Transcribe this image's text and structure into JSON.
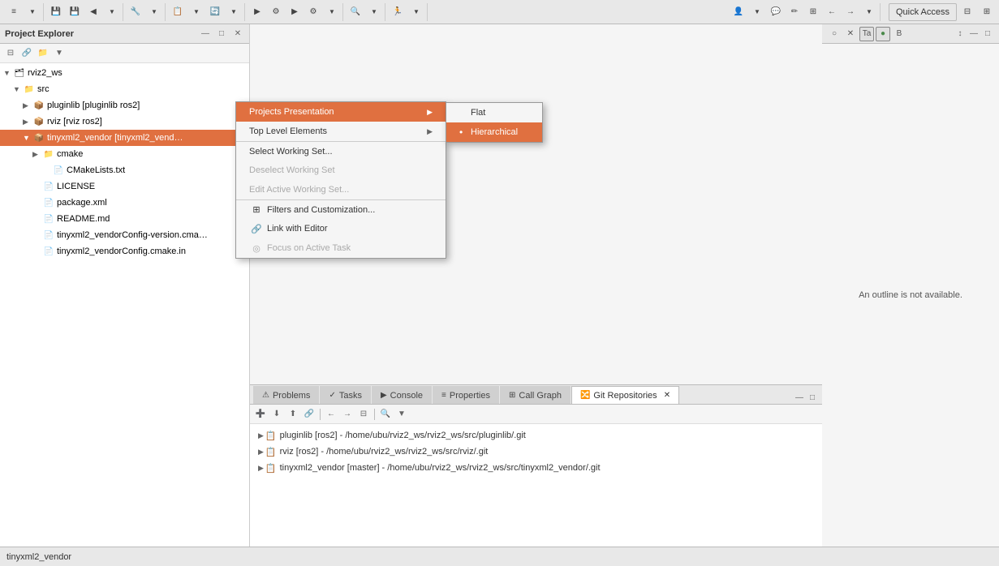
{
  "toolbar": {
    "quick_access_label": "Quick Access",
    "buttons": [
      "≡",
      "▼",
      "💾",
      "💾",
      "◀",
      "▼",
      "🔧",
      "▼",
      "📋",
      "▼",
      "🔄",
      "▼",
      "▶",
      "▼",
      "⚙",
      "▼",
      "▶",
      "⚙",
      "▼",
      "🔍",
      "▼",
      "🏃",
      "▼"
    ]
  },
  "project_explorer": {
    "title": "Project Explorer",
    "workspace": "rviz2_ws",
    "items": [
      {
        "label": "rviz2_ws",
        "type": "workspace",
        "indent": 0,
        "expanded": true
      },
      {
        "label": "src",
        "type": "folder",
        "indent": 1,
        "expanded": true
      },
      {
        "label": "pluginlib [pluginlib ros2]",
        "type": "project",
        "indent": 2,
        "expanded": false
      },
      {
        "label": "rviz [rviz ros2]",
        "type": "project",
        "indent": 2,
        "expanded": false
      },
      {
        "label": "tinyxml2_vendor [tinyxml2_vend...",
        "type": "project",
        "indent": 2,
        "selected": true,
        "expanded": true
      },
      {
        "label": "cmake",
        "type": "folder",
        "indent": 3,
        "expanded": false
      },
      {
        "label": "CMakeLists.txt",
        "type": "file",
        "indent": 4
      },
      {
        "label": "LICENSE",
        "type": "file",
        "indent": 3
      },
      {
        "label": "package.xml",
        "type": "file",
        "indent": 3
      },
      {
        "label": "README.md",
        "type": "file",
        "indent": 3
      },
      {
        "label": "tinyxml2_vendorConfig-version.cma...",
        "type": "file",
        "indent": 3
      },
      {
        "label": "tinyxml2_vendorConfig.cmake.in",
        "type": "file",
        "indent": 3
      }
    ]
  },
  "context_menu": {
    "items": [
      {
        "label": "Projects Presentation",
        "has_arrow": true,
        "indent_level": 0
      },
      {
        "label": "Top Level Elements",
        "has_arrow": true,
        "indent_level": 0
      },
      {
        "label": "Select Working Set...",
        "separator_above": true,
        "indent_level": 0
      },
      {
        "label": "Deselect Working Set",
        "disabled": true,
        "indent_level": 0
      },
      {
        "label": "Edit Active Working Set...",
        "disabled": true,
        "indent_level": 0
      },
      {
        "label": "Filters and Customization...",
        "separator_above": true,
        "has_icon": true,
        "icon": "⊞",
        "indent_level": 0
      },
      {
        "label": "Link with Editor",
        "has_icon": true,
        "icon": "🔗",
        "indent_level": 0
      },
      {
        "label": "Focus on Active Task",
        "has_icon": true,
        "icon": "◎",
        "disabled": true,
        "indent_level": 0
      }
    ]
  },
  "submenu": {
    "items": [
      {
        "label": "Flat",
        "bullet": false
      },
      {
        "label": "Hierarchical",
        "bullet": true,
        "active": true
      }
    ]
  },
  "outline": {
    "message": "An outline is not available.",
    "buttons": [
      "○",
      "✕",
      "Ta",
      "●",
      "B"
    ]
  },
  "bottom_panel": {
    "tabs": [
      {
        "label": "Problems",
        "icon": "⚠",
        "active": false
      },
      {
        "label": "Tasks",
        "icon": "✓",
        "active": false
      },
      {
        "label": "Console",
        "icon": "▶",
        "active": false
      },
      {
        "label": "Properties",
        "icon": "≡",
        "active": false
      },
      {
        "label": "Call Graph",
        "icon": "⊞",
        "active": false
      },
      {
        "label": "Git Repositories",
        "icon": "🔀",
        "active": true
      }
    ],
    "repos": [
      {
        "label": "pluginlib [ros2]",
        "path": "- /home/ubu/rviz2_ws/rviz2_ws/src/pluginlib/.git"
      },
      {
        "label": "rviz [ros2]",
        "path": "- /home/ubu/rviz2_ws/rviz2_ws/src/rviz/.git"
      },
      {
        "label": "tinyxml2_vendor [master]",
        "path": "- /home/ubu/rviz2_ws/rviz2_ws/src/tinyxml2_vendor/.git"
      }
    ]
  },
  "status_bar": {
    "text": "tinyxml2_vendor"
  }
}
